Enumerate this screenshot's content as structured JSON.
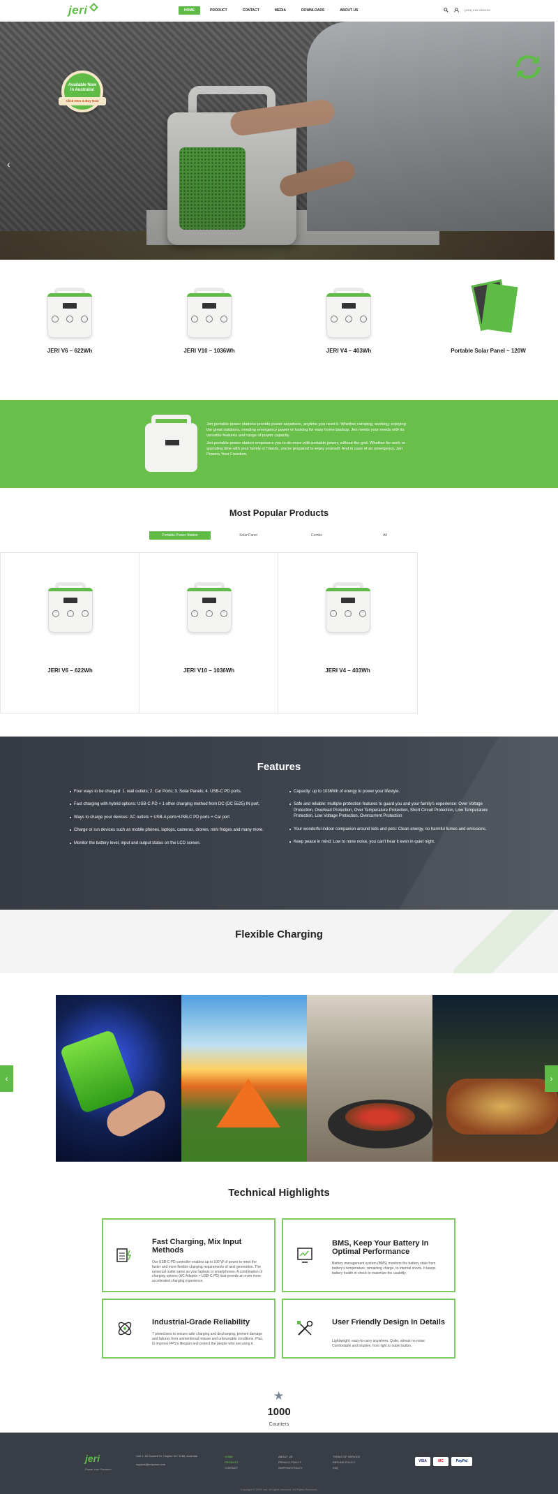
{
  "header": {
    "logo": "jeri",
    "nav": [
      "HOME",
      "PRODUCT",
      "CONTACT",
      "MEDIA",
      "DOWNLOADS",
      "ABOUT US"
    ],
    "phone": "(XXX) XXX XXXXXX"
  },
  "hero": {
    "badge_line1": "Available Now",
    "badge_line2": "In Australia!",
    "badge_ribbon": "Click Here & Buy Now",
    "prev": "‹"
  },
  "products": [
    {
      "name": "JERI V6 – 622Wh"
    },
    {
      "name": "JERI V10 – 1036Wh"
    },
    {
      "name": "JERI V4 – 403Wh"
    },
    {
      "name": "Portable Solar Panel – 120W"
    }
  ],
  "intro": {
    "p1": "Jeri portable power stations provide power anywhere, anytime you need it. Whether camping, working, enjoying the great outdoors, needing emergency power or looking for easy home backup, Jeri meets your needs with its versatile features and range of power capacity.",
    "p2": "Jeri portable power station empowers you to do more with portable power, without the grid. Whether for work or spending time with your family or friends, you're prepared to enjoy yourself. And in case of an emergency, Jeri Powers Your Freedom."
  },
  "popular": {
    "title": "Most Popular Products",
    "tabs": [
      "Portable Power Station",
      "Solar Panel",
      "Combo",
      "All"
    ],
    "items": [
      {
        "name": "JERI V6 – 622Wh"
      },
      {
        "name": "JERI V10 – 1036Wh"
      },
      {
        "name": "JERI V4 – 403Wh"
      }
    ]
  },
  "features": {
    "title": "Features",
    "left": [
      "Four ways to be charged: 1. wall outlets; 2. Car Ports; 3. Solar Panels; 4. USB-C PD ports.",
      "Fast charging with hybrid options: USB-C PD + 1 other charging method from DC (DC 5525) IN port.",
      "Ways to charge your devices: AC outlets + USB-A ports+USB-C PD ports + Car port",
      "Charge or run devices such as mobile phones, laptops, cameras, drones, mini fridges and many more.",
      "Monitor the battery level, input and output status on the LCD screen."
    ],
    "right": [
      "Capacity: up to 1036Wh of energy to power your lifestyle.",
      "Safe and reliable: multiple protection features to guard you and your family's experience: Over Voltage Protection, Overload Protection, Over Temperature Protection, Short Circuit Protection, Low Temperature Protection, Low Voltage Protection, Overcurrent Protection",
      "Your wonderful indoor companion around kids and pets: Clean energy, no harmful fumes and emissions.",
      "Keep peace in mind: Low to none noise, you can't hear it even in quiet night."
    ]
  },
  "flexible": {
    "title": "Flexible Charging",
    "prev": "‹",
    "next": "›"
  },
  "tech": {
    "title": "Technical Highlights",
    "cards": [
      {
        "title": "Fast Charging, Mix Input Methods",
        "desc": "Our USB-C PD controller enables up to 100 W of power to meet the faster and more flexible charging requirements of next generation. The universal outlet same as your laptops or smartphones. A combination of charging options (AC Adaptor + USB-C PD) that provide an even more accelerated charging experience.",
        "icon": "charging-icon"
      },
      {
        "title": "BMS, Keep Your Battery In Optimal Performance",
        "desc": "Battery management system (BMS) monitors the battery state from battery's temperature, remaining charge, to internal shorts. It keeps battery health in check to maximize the usability.",
        "icon": "monitor-icon"
      },
      {
        "title": "Industrial-Grade Reliability",
        "desc": "7 protections to ensure safe charging and discharging, prevent damage and failures from unintentional misuse and unfavorable conditions. Plus, to improve PPS's lifespan and protect the people who are using it.",
        "icon": "atom-icon"
      },
      {
        "title": "User Friendly Design In Details",
        "desc": "Lightweight, easy-to-carry anywhere. Quite, almost no noise. Comfortable and intuitive, from light to outlet button.",
        "icon": "tools-icon"
      }
    ]
  },
  "counter": {
    "value": "1000",
    "label": "Counters"
  },
  "footer": {
    "logo": "jeri",
    "slogan": "Power Your Freedom",
    "address": "Unit 1, 63 Scarlett St, Clayton VIC 3168, Australia",
    "email": "support@jeripower.com",
    "col1": [
      "HOME",
      "PRODUCT",
      "CONTACT"
    ],
    "col2": [
      "ABOUT US",
      "PRIVACY POLICY",
      "SHIPPING POLICY"
    ],
    "col3": [
      "TERMS OF SERVICE",
      "REFUND POLICY",
      "FAQ"
    ],
    "payments": [
      "VISA",
      "MC",
      "PayPal"
    ],
    "copyright": "Copyright © 2023 Jeri. All rights reserved. All Rights Reserved."
  },
  "colors": {
    "accent": "#5dbb46",
    "dark": "#393e46"
  }
}
